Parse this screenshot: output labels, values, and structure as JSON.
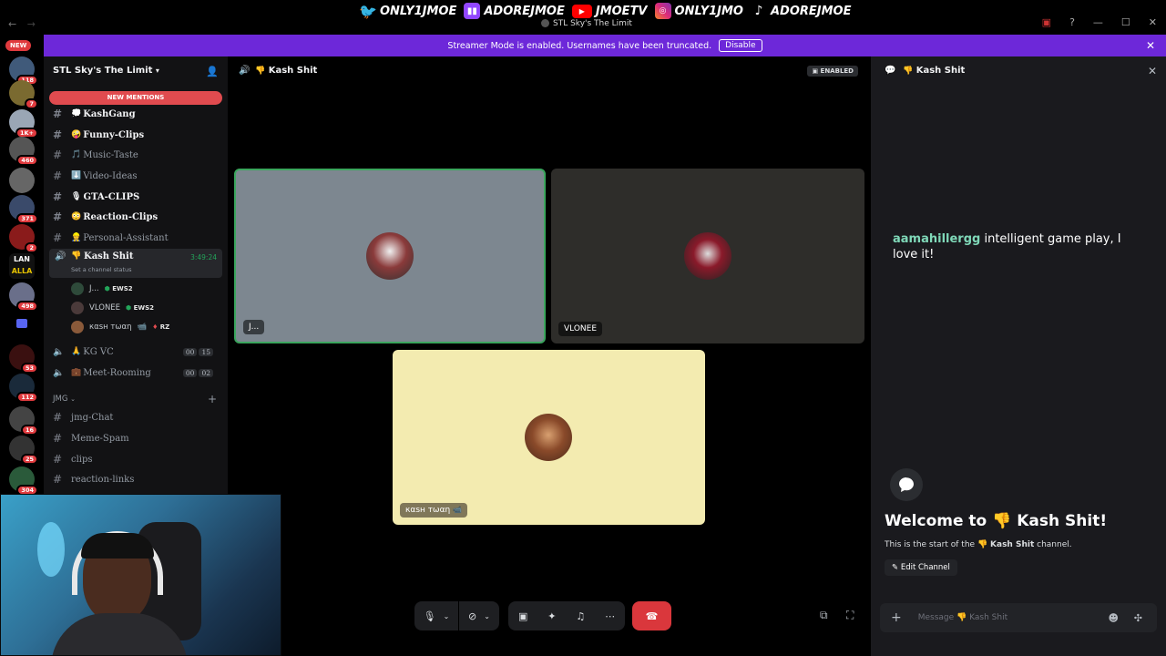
{
  "overlay": {
    "twitter": "ONLY1JMOE",
    "twitch": "ADOREJMOE",
    "youtube": "JMOETV",
    "instagram": "ONLY1JMO",
    "tiktok": "ADOREJMOE"
  },
  "window": {
    "title": "STL Sky's The Limit"
  },
  "banner": {
    "text": "Streamer Mode is enabled. Usernames have been truncated.",
    "button": "Disable"
  },
  "guilds": {
    "new_label": "NEW",
    "badges": [
      "118",
      "7",
      "1K+",
      "460",
      "371",
      "2",
      "498",
      "53",
      "112",
      "16",
      "25",
      "304"
    ],
    "lan_text": "LAN",
    "alla_text": "ALLA"
  },
  "sidebar": {
    "server_name": "STL Sky's The Limit",
    "new_mentions": "NEW MENTIONS",
    "channels": [
      {
        "emoji": "💭",
        "label": "KashGang",
        "bold": true
      },
      {
        "emoji": "🤪",
        "label": "Funny-Clips",
        "bold": true
      },
      {
        "emoji": "🎵",
        "label": "Music-Taste",
        "bold": false
      },
      {
        "emoji": "⬇️",
        "label": "Video-Ideas",
        "bold": false
      },
      {
        "emoji": "🎙",
        "label": "GTA-CLIPS",
        "bold": true
      },
      {
        "emoji": "😳",
        "label": "Reaction-Clips",
        "bold": true
      },
      {
        "emoji": "👷",
        "label": "Personal-Assistant",
        "bold": false
      }
    ],
    "voice_active": {
      "emoji": "👎",
      "label": "Kash Shit",
      "timer": "3:49:24",
      "status": "Set a channel status"
    },
    "voice_users": [
      {
        "name": "J...",
        "tag": "EWS2"
      },
      {
        "name": "VLONEE",
        "tag": "EWS2"
      },
      {
        "name": "кαѕн тωαη",
        "tag": "RZ"
      }
    ],
    "voice_channels": [
      {
        "emoji": "🙏",
        "label": "KG VC",
        "a": "00",
        "b": "15"
      },
      {
        "emoji": "💼",
        "label": "Meet-Rooming",
        "a": "00",
        "b": "02"
      }
    ],
    "category": "JMG",
    "cat_channels": [
      {
        "label": "jmg-Chat"
      },
      {
        "label": "Meme-Spam"
      },
      {
        "label": "clips"
      },
      {
        "label": "reaction-links"
      }
    ]
  },
  "main": {
    "emoji": "👎",
    "title": "Kash Shit",
    "enabled_label": "ENABLED",
    "tiles": [
      {
        "name": "J..."
      },
      {
        "name": "VLONEE"
      },
      {
        "name": "кαѕн тωαη"
      }
    ]
  },
  "chat": {
    "emoji": "👎",
    "title": "Kash Shit",
    "message_user": "aamahillergg",
    "message_text": "intelligent game play, I love it!",
    "welcome_prefix": "Welcome to",
    "welcome_channel": "Kash Shit!",
    "start_prefix": "This is the start of the",
    "start_channel": "Kash Shit",
    "start_suffix": "channel.",
    "edit_button": "Edit Channel",
    "input_prefix": "Message",
    "input_channel": "Kash Shit"
  },
  "colors": {
    "accent": "#6d28d9",
    "danger": "#da373c",
    "tile1": "#7d8790",
    "tile2": "#2e2d2a",
    "tile3": "#f3ebb0"
  }
}
